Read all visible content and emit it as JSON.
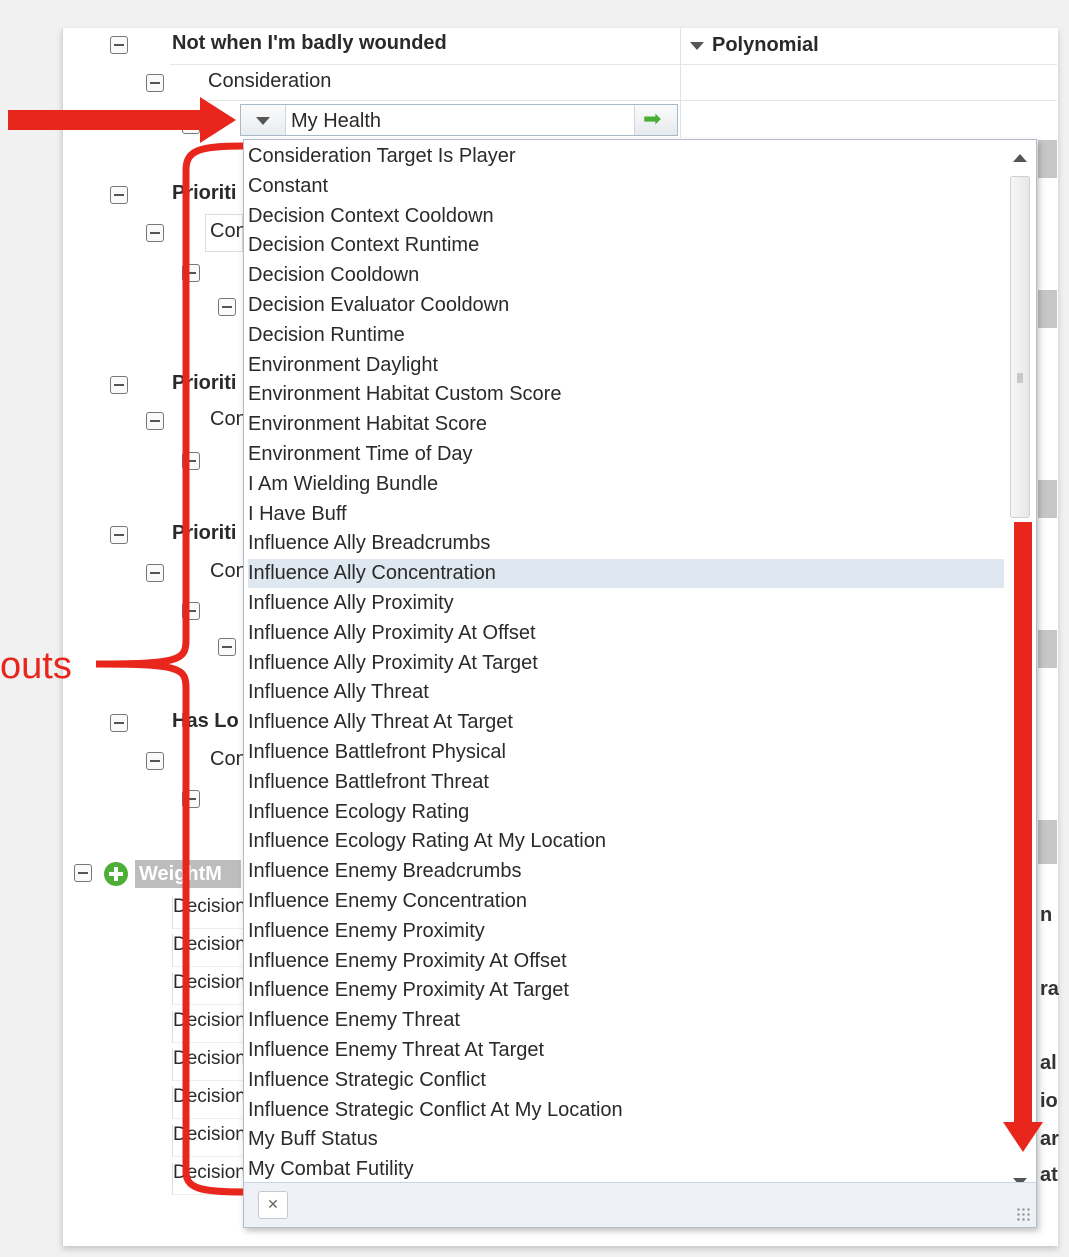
{
  "tree": {
    "root_label": "Not when I'm badly wounded",
    "consideration_label": "Consideration",
    "curve_type": "Polynomial",
    "combo_value": "My Health",
    "partial_labels": [
      "Prioriti",
      "Prioriti",
      "Prioriti",
      "Has Lo"
    ],
    "partial_con": [
      "Con",
      "Con",
      "Con",
      "Con"
    ],
    "weight_label": "WeightM",
    "decision_labels": [
      "Decision",
      "Decision",
      "Decision",
      "Decision",
      "Decision",
      "Decision",
      "Decision",
      "Decision"
    ],
    "right_fragments": [
      "n",
      "ra",
      "al",
      "io",
      "ar",
      "at"
    ]
  },
  "dropdown": {
    "selected": "Influence Ally Concentration",
    "options": [
      "Consideration Target Is Player",
      "Constant",
      "Decision Context Cooldown",
      "Decision Context Runtime",
      "Decision Cooldown",
      "Decision Evaluator Cooldown",
      "Decision Runtime",
      "Environment Daylight",
      "Environment Habitat Custom Score",
      "Environment Habitat Score",
      "Environment Time of Day",
      "I Am Wielding Bundle",
      "I Have Buff",
      "Influence Ally Breadcrumbs",
      "Influence Ally Concentration",
      "Influence Ally Proximity",
      "Influence Ally Proximity At Offset",
      "Influence Ally Proximity At Target",
      "Influence Ally Threat",
      "Influence Ally Threat At Target",
      "Influence Battlefront Physical",
      "Influence Battlefront Threat",
      "Influence Ecology Rating",
      "Influence Ecology Rating At My Location",
      "Influence Enemy Breadcrumbs",
      "Influence Enemy Concentration",
      "Influence Enemy Proximity",
      "Influence Enemy Proximity At Offset",
      "Influence Enemy Proximity At Target",
      "Influence Enemy Threat",
      "Influence Enemy Threat At Target",
      "Influence Strategic Conflict",
      "Influence Strategic Conflict At My Location",
      "My Buff Status",
      "My Combat Futility"
    ],
    "clear_symbol": "✕"
  },
  "annotation": {
    "text": "outs",
    "color": "#e8261c"
  },
  "colors": {
    "accent_green": "#4caf35",
    "selection": "#dfe7f1"
  }
}
